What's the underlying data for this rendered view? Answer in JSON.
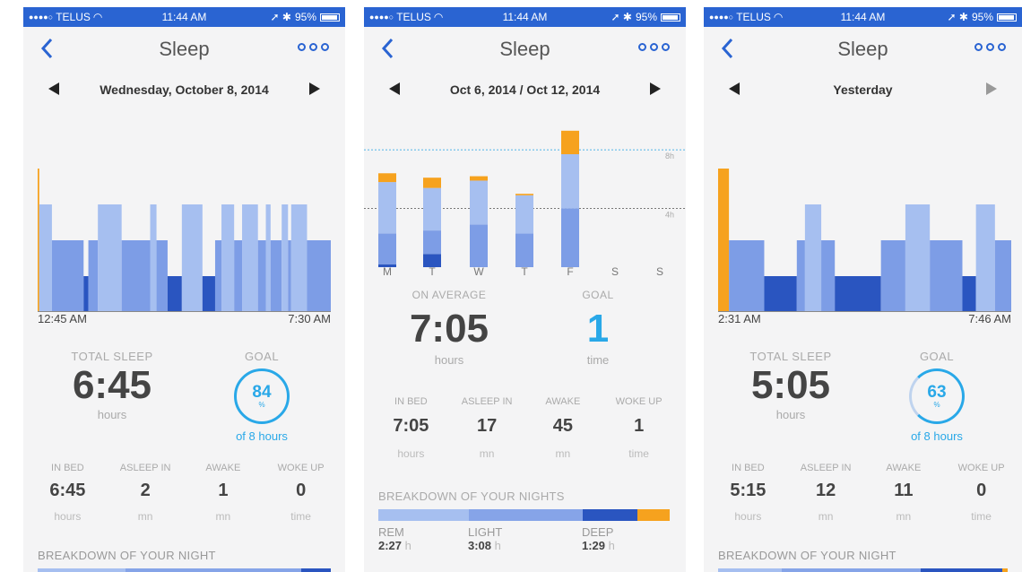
{
  "status_bar": {
    "signal": "●●●●○",
    "carrier": "TELUS",
    "wifi": "wifi-icon",
    "time": "11:44 AM",
    "indicators": "➚ ✱",
    "battery": "95%"
  },
  "colors": {
    "status_bar": "#2a64d2",
    "light_blue": "#a6bff0",
    "mid_blue": "#86a4e8",
    "blue": "#7d9de6",
    "dark_blue": "#2a55c0",
    "orange": "#f6a21e",
    "goal_blue": "#29a8e8"
  },
  "screens": [
    {
      "nav_title": "Sleep",
      "date": "Wednesday, October 8, 2014",
      "time_start": "12:45 AM",
      "time_end": "7:30 AM",
      "total_label": "TOTAL SLEEP",
      "total": "6:45",
      "total_unit": "hours",
      "goal_label": "GOAL",
      "goal_pct": "84",
      "goal_pct_sym": "%",
      "goal_sub": "of 8 hours",
      "stats": [
        {
          "label": "IN BED",
          "value": "6:45",
          "unit": "hours"
        },
        {
          "label": "ASLEEP IN",
          "value": "2",
          "unit": "mn"
        },
        {
          "label": "AWAKE",
          "value": "1",
          "unit": "mn"
        },
        {
          "label": "WOKE UP",
          "value": "0",
          "unit": "time"
        }
      ],
      "breakdown_label": "BREAKDOWN OF YOUR NIGHT"
    },
    {
      "nav_title": "Sleep",
      "date": "Oct 6, 2014 / Oct 12, 2014",
      "days": [
        "M",
        "T",
        "W",
        "T",
        "F",
        "S",
        "S"
      ],
      "ref_high": "8h",
      "ref_low": "4h",
      "avg_label": "ON AVERAGE",
      "avg": "7:05",
      "avg_unit": "hours",
      "goal_label": "GOAL",
      "goal": "1",
      "goal_unit": "time",
      "stats": [
        {
          "label": "IN BED",
          "value": "7:05",
          "unit": "hours"
        },
        {
          "label": "ASLEEP IN",
          "value": "17",
          "unit": "mn"
        },
        {
          "label": "AWAKE",
          "value": "45",
          "unit": "mn"
        },
        {
          "label": "WOKE UP",
          "value": "1",
          "unit": "time"
        }
      ],
      "breakdown_label": "BREAKDOWN OF YOUR NIGHTS",
      "legend": [
        {
          "name": "REM",
          "value": "2:27",
          "unit": "h"
        },
        {
          "name": "LIGHT",
          "value": "3:08",
          "unit": "h"
        },
        {
          "name": "DEEP",
          "value": "1:29",
          "unit": "h"
        }
      ]
    },
    {
      "nav_title": "Sleep",
      "date": "Yesterday",
      "time_start": "2:31 AM",
      "time_end": "7:46 AM",
      "total_label": "TOTAL SLEEP",
      "total": "5:05",
      "total_unit": "hours",
      "goal_label": "GOAL",
      "goal_pct": "63",
      "goal_pct_sym": "%",
      "goal_sub": "of 8 hours",
      "stats": [
        {
          "label": "IN BED",
          "value": "5:15",
          "unit": "hours"
        },
        {
          "label": "ASLEEP IN",
          "value": "12",
          "unit": "mn"
        },
        {
          "label": "AWAKE",
          "value": "11",
          "unit": "mn"
        },
        {
          "label": "WOKE UP",
          "value": "0",
          "unit": "time"
        }
      ],
      "breakdown_label": "BREAKDOWN OF YOUR NIGHT"
    }
  ],
  "chart_data": [
    {
      "type": "bar",
      "stage_scale": {
        "awake": 4,
        "rem": 3,
        "light": 2,
        "deep": 1
      },
      "segments": [
        {
          "stage": "awake",
          "duration": 1
        },
        {
          "stage": "rem",
          "duration": 8
        },
        {
          "stage": "light",
          "duration": 20
        },
        {
          "stage": "deep",
          "duration": 3
        },
        {
          "stage": "light",
          "duration": 6
        },
        {
          "stage": "rem",
          "duration": 15
        },
        {
          "stage": "light",
          "duration": 18
        },
        {
          "stage": "rem",
          "duration": 4
        },
        {
          "stage": "light",
          "duration": 7
        },
        {
          "stage": "deep",
          "duration": 9
        },
        {
          "stage": "rem",
          "duration": 13
        },
        {
          "stage": "deep",
          "duration": 8
        },
        {
          "stage": "light",
          "duration": 4
        },
        {
          "stage": "rem",
          "duration": 8
        },
        {
          "stage": "light",
          "duration": 5
        },
        {
          "stage": "rem",
          "duration": 10
        },
        {
          "stage": "light",
          "duration": 5
        },
        {
          "stage": "rem",
          "duration": 3
        },
        {
          "stage": "light",
          "duration": 7
        },
        {
          "stage": "rem",
          "duration": 4
        },
        {
          "stage": "light",
          "duration": 2
        },
        {
          "stage": "rem",
          "duration": 10
        },
        {
          "stage": "light",
          "duration": 15
        }
      ]
    },
    {
      "type": "bar",
      "categories": [
        "M",
        "T",
        "W",
        "T",
        "F",
        "S",
        "S"
      ],
      "ylim": [
        0,
        11
      ],
      "series": [
        {
          "name": "DEEP",
          "values": [
            0.2,
            0.9,
            0,
            0,
            0,
            0,
            0
          ]
        },
        {
          "name": "LIGHT",
          "values": [
            2.1,
            1.6,
            2.9,
            2.3,
            4.0,
            0,
            0
          ]
        },
        {
          "name": "REM",
          "values": [
            3.5,
            2.9,
            3.0,
            2.6,
            3.7,
            0,
            0
          ]
        },
        {
          "name": "AWAKE",
          "values": [
            0.6,
            0.7,
            0.3,
            0.1,
            1.6,
            0,
            0
          ]
        }
      ],
      "reference_lines": [
        {
          "label": "8h",
          "value": 8
        },
        {
          "label": "4h",
          "value": 4
        }
      ]
    },
    {
      "type": "bar",
      "stage_scale": {
        "awake": 4,
        "rem": 3,
        "light": 2,
        "deep": 1
      },
      "segments": [
        {
          "stage": "awake",
          "duration": 4
        },
        {
          "stage": "light",
          "duration": 13
        },
        {
          "stage": "deep",
          "duration": 12
        },
        {
          "stage": "light",
          "duration": 3
        },
        {
          "stage": "rem",
          "duration": 6
        },
        {
          "stage": "light",
          "duration": 5
        },
        {
          "stage": "deep",
          "duration": 17
        },
        {
          "stage": "light",
          "duration": 9
        },
        {
          "stage": "rem",
          "duration": 9
        },
        {
          "stage": "light",
          "duration": 12
        },
        {
          "stage": "deep",
          "duration": 5
        },
        {
          "stage": "rem",
          "duration": 7
        },
        {
          "stage": "light",
          "duration": 6
        }
      ]
    }
  ]
}
